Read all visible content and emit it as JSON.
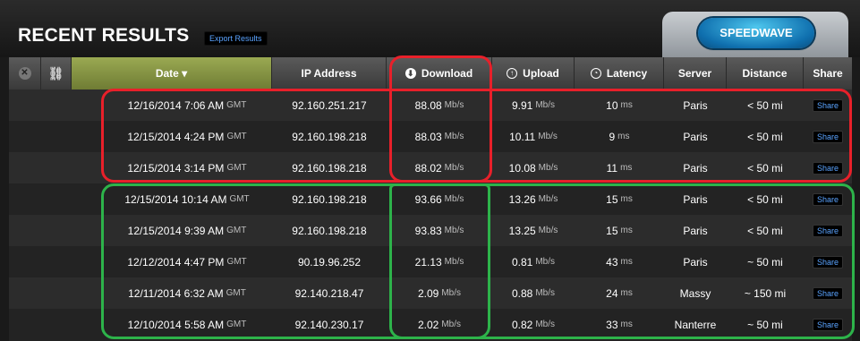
{
  "header": {
    "title": "RECENT RESULTS",
    "export_label": "Export Results",
    "brand_label": "SPEEDWAVE"
  },
  "columns": {
    "date": "Date ▾",
    "ip": "IP Address",
    "download": "Download",
    "upload": "Upload",
    "latency": "Latency",
    "server": "Server",
    "distance": "Distance",
    "share": "Share"
  },
  "units": {
    "speed": "Mb/s",
    "latency": "ms",
    "tz": "GMT"
  },
  "rows": [
    {
      "date": "12/16/2014 7:06 AM",
      "ip": "92.160.251.217",
      "download": "88.08",
      "upload": "9.91",
      "latency": "10",
      "server": "Paris",
      "distance": "< 50 mi",
      "share": "Share"
    },
    {
      "date": "12/15/2014 4:24 PM",
      "ip": "92.160.198.218",
      "download": "88.03",
      "upload": "10.11",
      "latency": "9",
      "server": "Paris",
      "distance": "< 50 mi",
      "share": "Share"
    },
    {
      "date": "12/15/2014 3:14 PM",
      "ip": "92.160.198.218",
      "download": "88.02",
      "upload": "10.08",
      "latency": "11",
      "server": "Paris",
      "distance": "< 50 mi",
      "share": "Share"
    },
    {
      "date": "12/15/2014 10:14 AM",
      "ip": "92.160.198.218",
      "download": "93.66",
      "upload": "13.26",
      "latency": "15",
      "server": "Paris",
      "distance": "< 50 mi",
      "share": "Share"
    },
    {
      "date": "12/15/2014 9:39 AM",
      "ip": "92.160.198.218",
      "download": "93.83",
      "upload": "13.25",
      "latency": "15",
      "server": "Paris",
      "distance": "< 50 mi",
      "share": "Share"
    },
    {
      "date": "12/12/2014 4:47 PM",
      "ip": "90.19.96.252",
      "download": "21.13",
      "upload": "0.81",
      "latency": "43",
      "server": "Paris",
      "distance": "~ 50 mi",
      "share": "Share"
    },
    {
      "date": "12/11/2014 6:32 AM",
      "ip": "92.140.218.47",
      "download": "2.09",
      "upload": "0.88",
      "latency": "24",
      "server": "Massy",
      "distance": "~ 150 mi",
      "share": "Share"
    },
    {
      "date": "12/10/2014 5:58 AM",
      "ip": "92.140.230.17",
      "download": "2.02",
      "upload": "0.82",
      "latency": "33",
      "server": "Nanterre",
      "distance": "~ 50 mi",
      "share": "Share"
    }
  ],
  "annotation_colors": {
    "red": "#e8202a",
    "green": "#2db34a"
  }
}
